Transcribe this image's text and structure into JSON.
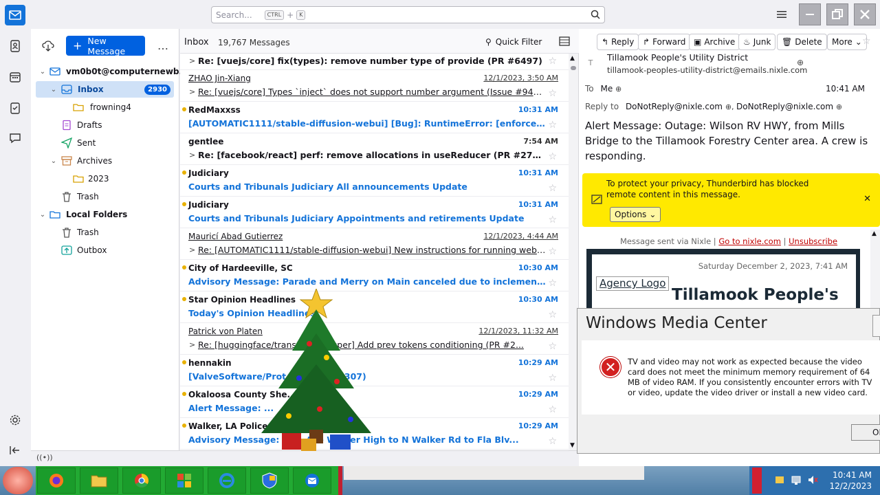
{
  "search": {
    "placeholder": "Search...",
    "kbd_ctrl": "CTRL",
    "kbd_plus": "+",
    "kbd_k": "K"
  },
  "folders": {
    "new_message_label": "New Message",
    "account": "vm0b0t@computernewb...",
    "items": [
      {
        "label": "Inbox",
        "badge": "2930"
      },
      {
        "label": "frowning4"
      },
      {
        "label": "Drafts"
      },
      {
        "label": "Sent"
      },
      {
        "label": "Archives"
      },
      {
        "label": "2023"
      },
      {
        "label": "Trash"
      },
      {
        "label": "Local Folders"
      },
      {
        "label": "Trash"
      },
      {
        "label": "Outbox"
      }
    ]
  },
  "list": {
    "folder_title": "Inbox",
    "count": "19,767 Messages",
    "quick_filter": "Quick Filter",
    "rows": [
      {
        "from": "",
        "date": "",
        "subject": "Re: [vuejs/core] fix(types): remove number type of provide (PR #6497)"
      },
      {
        "from": "ZHAO Jin-Xiang",
        "date": "12/1/2023, 3:50 AM",
        "subject": "Re: [vuejs/core] Types `inject` does not support number argument (Issue #9439)"
      },
      {
        "from": "RedMaxxss",
        "date": "10:31 AM",
        "subject": "[AUTOMATIC1111/stable-diffusion-webui] [Bug]: RuntimeError: [enforce fail at ....."
      },
      {
        "from": "gentlee",
        "date": "7:54 AM",
        "subject": "Re: [facebook/react] perf: remove allocations in useReducer (PR #27383)"
      },
      {
        "from": "Judiciary",
        "date": "10:31 AM",
        "subject": "Courts and Tribunals Judiciary All announcements Update"
      },
      {
        "from": "Judiciary",
        "date": "10:31 AM",
        "subject": "Courts and Tribunals Judiciary Appointments and retirements Update"
      },
      {
        "from": "Mauricí Abad Gutierrez",
        "date": "12/1/2023, 4:44 AM",
        "subject": "Re: [AUTOMATIC1111/stable-diffusion-webui] New instructions for running web UI o..."
      },
      {
        "from": "City of Hardeeville, SC",
        "date": "10:30 AM",
        "subject": "Advisory Message: Parade and Merry on Main canceled due to inclement weather"
      },
      {
        "from": "Star Opinion Headlines",
        "date": "10:30 AM",
        "subject": "Today's Opinion Headlines"
      },
      {
        "from": "Patrick von Platen",
        "date": "12/1/2023, 11:32 AM",
        "subject": "Re: [huggingface/transf...] [Whisper] Add prev tokens conditioning (PR #2..."
      },
      {
        "from": "hennakin",
        "date": "10:29 AM",
        "subject": "[ValveSoftware/Prot... (Issue #7307)"
      },
      {
        "from": "Okaloosa County She...",
        "date": "10:29 AM",
        "subject": "Alert Message: ..."
      },
      {
        "from": "Walker, LA Police Depa...",
        "date": "10:29 AM",
        "subject": "Advisory Message: At... Ave Walker High to N Walker Rd to Fla Blv..."
      }
    ]
  },
  "message": {
    "toolbar": {
      "reply": "Reply",
      "forward": "Forward",
      "archive": "Archive",
      "junk": "Junk",
      "delete": "Delete",
      "more": "More"
    },
    "sender_name": "Tillamook People's Utility District",
    "sender_email": "tillamook-peoples-utility-district@emails.nixle.com",
    "to_label": "To",
    "to_value": "Me",
    "time": "10:41 AM",
    "reply_to_label": "Reply to",
    "reply_to_1": "DoNotReply@nixle.com",
    "reply_to_2": "DoNotReply@nixle.com",
    "subject": "Alert Message: Outage: Wilson RV HWY, from Mills Bridge to the Tillamook Forestry Center area. A crew is responding.",
    "remote_notice": "To protect your privacy, Thunderbird has blocked remote content in this message.",
    "options_label": "Options",
    "nixle_prefix": "Message sent via Nixle |",
    "nixle_link": "Go to nixle.com",
    "nixle_sep": "|",
    "unsubscribe": "Unsubscribe",
    "email_date": "Saturday December 2, 2023, 7:41 AM",
    "agency_logo": "Agency Logo",
    "email_title": "Tillamook People's"
  },
  "dialog": {
    "title": "Windows Media Center",
    "text": "TV and video may not work as expected because the video card does not meet the minimum memory requirement of 64 MB of video RAM. If you consistently encounter errors with TV or video, update the video driver or install a new video card.",
    "ok": "OK"
  },
  "taskbar": {
    "time": "10:41 AM",
    "date": "12/2/2023"
  },
  "colors": {
    "accent": "#0061e0",
    "unread": "#1373d9",
    "notice": "#ffe900",
    "taskbar_green": "#22aa33"
  }
}
